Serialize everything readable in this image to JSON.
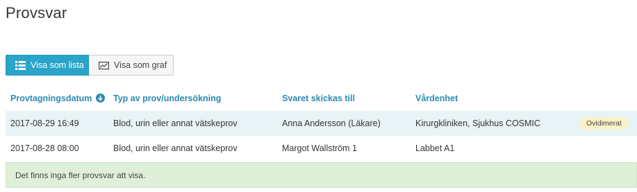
{
  "page": {
    "title": "Provsvar"
  },
  "view_toggle": {
    "list_label": "Visa som lista",
    "graph_label": "Visa som graf",
    "active": "list"
  },
  "table": {
    "headers": {
      "date": "Provtagningsdatum",
      "type": "Typ av prov/undersökning",
      "recipient": "Svaret skickas till",
      "unit": "Vårdenhet"
    },
    "sort": {
      "column": "date",
      "direction": "descending",
      "icon": "arrow-down-circle-icon"
    },
    "rows": [
      {
        "date": "2017-08-29 16:49",
        "type": "Blod, urin eller annat vätskeprov",
        "recipient": "Anna Andersson (Läkare)",
        "unit": "Kirurgkliniken, Sjukhus COSMIC",
        "badge": "Ovidimerat"
      },
      {
        "date": "2017-08-28 08:00",
        "type": "Blod, urin eller annat vätskeprov",
        "recipient": "Margot Wallström 1",
        "unit": "Labbet A1"
      }
    ]
  },
  "info": {
    "message": "Det finns inga fler provsvar att visa."
  },
  "colors": {
    "accent": "#2aa4c9",
    "header_text": "#2a8ab0",
    "stripe": "#e8f3f5",
    "badge_bg": "#faf1c8",
    "info_bg": "#dff0d8"
  }
}
